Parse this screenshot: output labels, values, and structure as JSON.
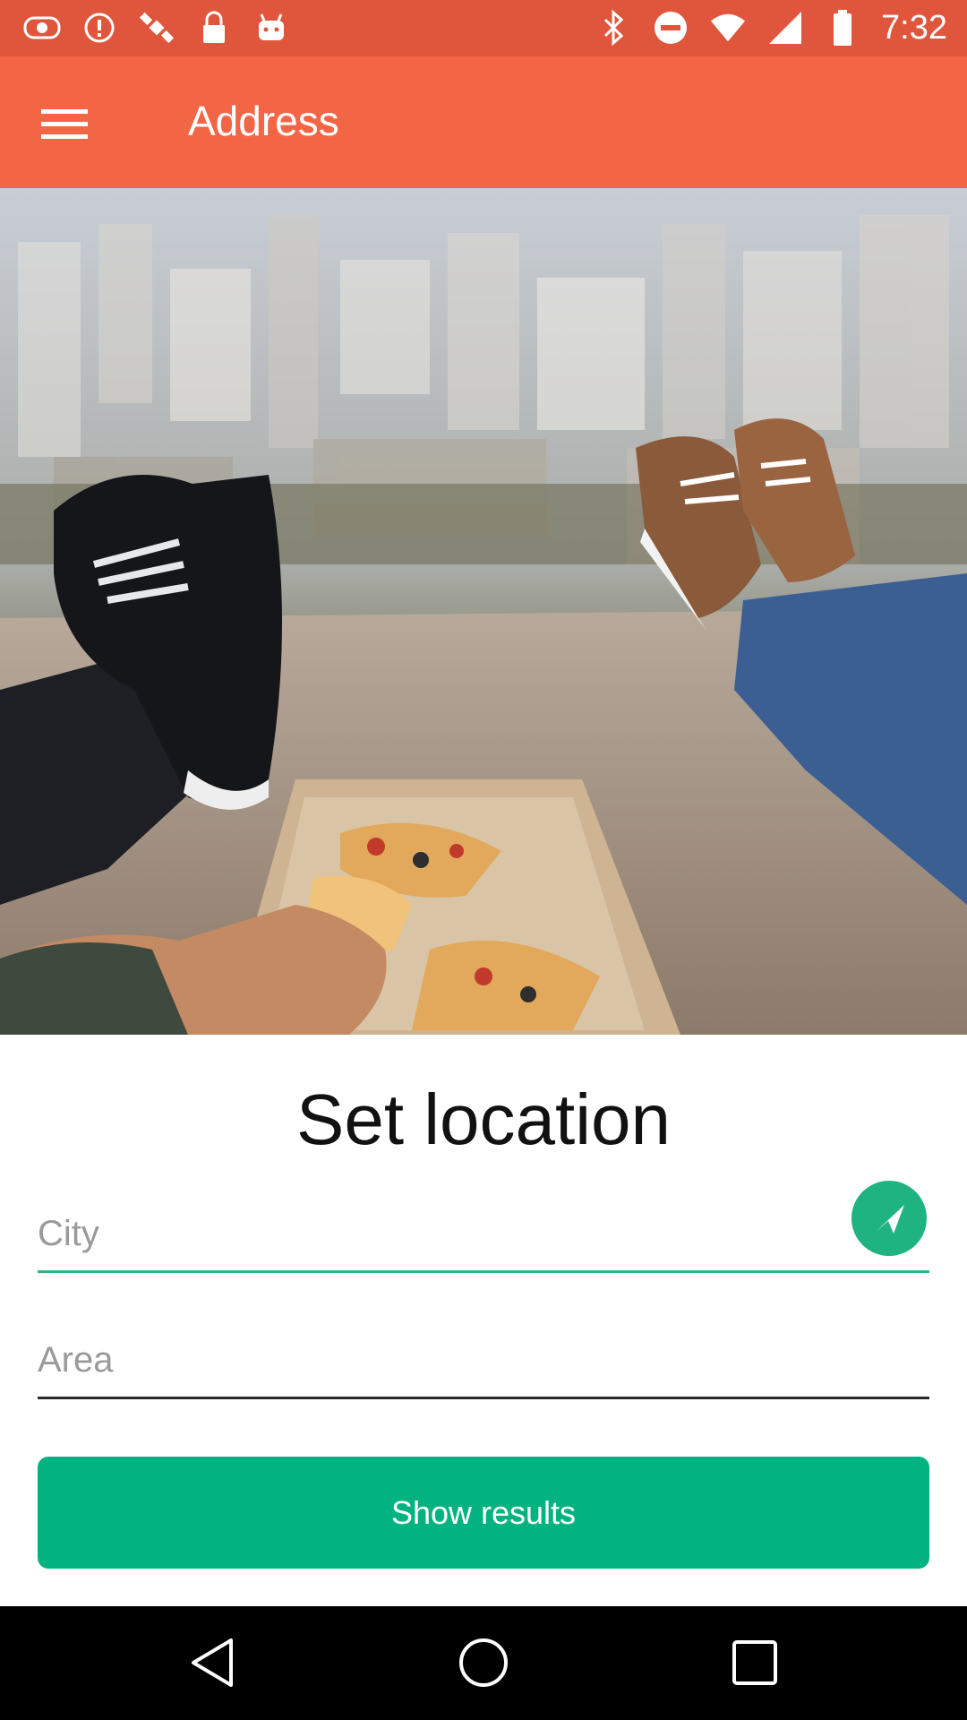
{
  "status_bar": {
    "time": "7:32",
    "left_icons": [
      "app-notification-icon",
      "alert-icon",
      "satellite-icon",
      "lock-icon",
      "android-icon"
    ],
    "right_icons": [
      "bluetooth-icon",
      "do-not-disturb-icon",
      "wifi-icon",
      "signal-icon",
      "battery-icon"
    ]
  },
  "app_bar": {
    "title": "Address",
    "menu_icon": "hamburger-menu-icon",
    "background": "#f26646"
  },
  "hero": {
    "image": "photo of two people relaxing on a ledge with pizza above a city"
  },
  "main": {
    "heading": "Set location",
    "city_placeholder": "City",
    "area_placeholder": "Area",
    "locate_icon": "compass-navigation-icon",
    "show_results_label": "Show results",
    "accent": "#02b381"
  },
  "nav_bar": {
    "items": [
      "back-icon",
      "home-icon",
      "recents-icon"
    ]
  }
}
